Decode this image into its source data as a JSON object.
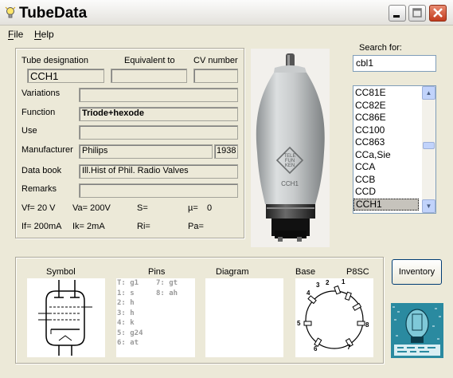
{
  "window": {
    "title": "TubeData"
  },
  "menu": {
    "file": "File",
    "help": "Help"
  },
  "labels": {
    "designation": "Tube designation",
    "equivalent": "Equivalent to",
    "cv": "CV number",
    "variations": "Variations",
    "function": "Function",
    "use": "Use",
    "manufacturer": "Manufacturer",
    "databook": "Data book",
    "remarks": "Remarks",
    "search": "Search for:",
    "symbol": "Symbol",
    "pins": "Pins",
    "diagram": "Diagram",
    "base": "Base"
  },
  "fields": {
    "designation": "CCH1",
    "equivalent": "",
    "cv": "",
    "variations": "",
    "function": "Triode+hexode",
    "use": "",
    "manufacturer": "Philips",
    "year": "1938",
    "databook": "Ill.Hist of Phil. Radio Valves",
    "remarks": ""
  },
  "params": {
    "vf": "Vf= 20 V",
    "va": "Va= 200V",
    "s": "S=",
    "mu": "µ=",
    "mu_val": "0",
    "if": "If= 200mA",
    "ik": "Ik=  2mA",
    "ri": "Ri=",
    "pa": "Pa="
  },
  "search": {
    "value": "cbl1"
  },
  "tube_list": [
    "CC81E",
    "CC82E",
    "CC86E",
    "CC100",
    "CC863",
    "CCa,Sie",
    "CCA",
    "CCB",
    "CCD",
    "CCH1"
  ],
  "selected_tube": "CCH1",
  "base_type": "P8SC",
  "pins": [
    "T: g1",
    "1: s",
    "2: h",
    "3: h",
    "4: k",
    "5: g24",
    "6: at",
    "7: gt",
    "8: ah"
  ],
  "base_pin_numbers": [
    "1",
    "2",
    "3",
    "4",
    "5",
    "6",
    "7",
    "8"
  ],
  "tube_logo": "TELEFUNKEN",
  "tube_print": "CCH1",
  "buttons": {
    "inventory": "Inventory"
  },
  "colors": {
    "titlebar": "#ece9d8",
    "close": "#c23c1e",
    "selection": "#c6c3bc"
  }
}
